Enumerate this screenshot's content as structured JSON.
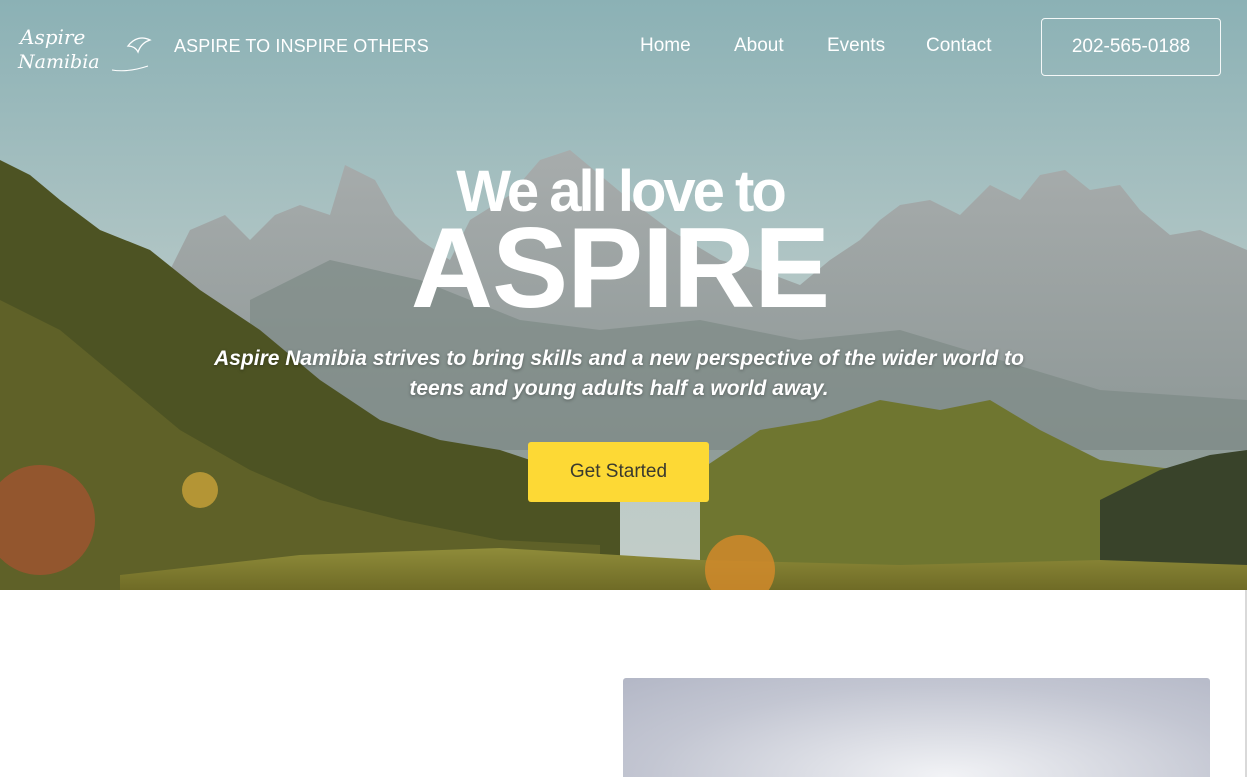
{
  "brand": {
    "logo_text_line1": "Aspire",
    "logo_text_line2": "Namibia",
    "tagline": "ASPIRE TO INSPIRE OTHERS"
  },
  "nav": {
    "items": [
      {
        "label": "Home"
      },
      {
        "label": "About"
      },
      {
        "label": "Events"
      },
      {
        "label": "Contact"
      }
    ],
    "phone": "202-565-0188"
  },
  "hero": {
    "headline_small": "We all love to",
    "headline_big": "ASPIRE",
    "subtitle": "Aspire Namibia strives to bring skills and a new perspective of the wider world to teens and young adults half a world away.",
    "cta_label": "Get Started",
    "background_image": "mountain-valley-landscape"
  },
  "colors": {
    "accent": "#fdd935",
    "text_on_hero": "#ffffff",
    "cta_text": "#3a3a2e"
  }
}
